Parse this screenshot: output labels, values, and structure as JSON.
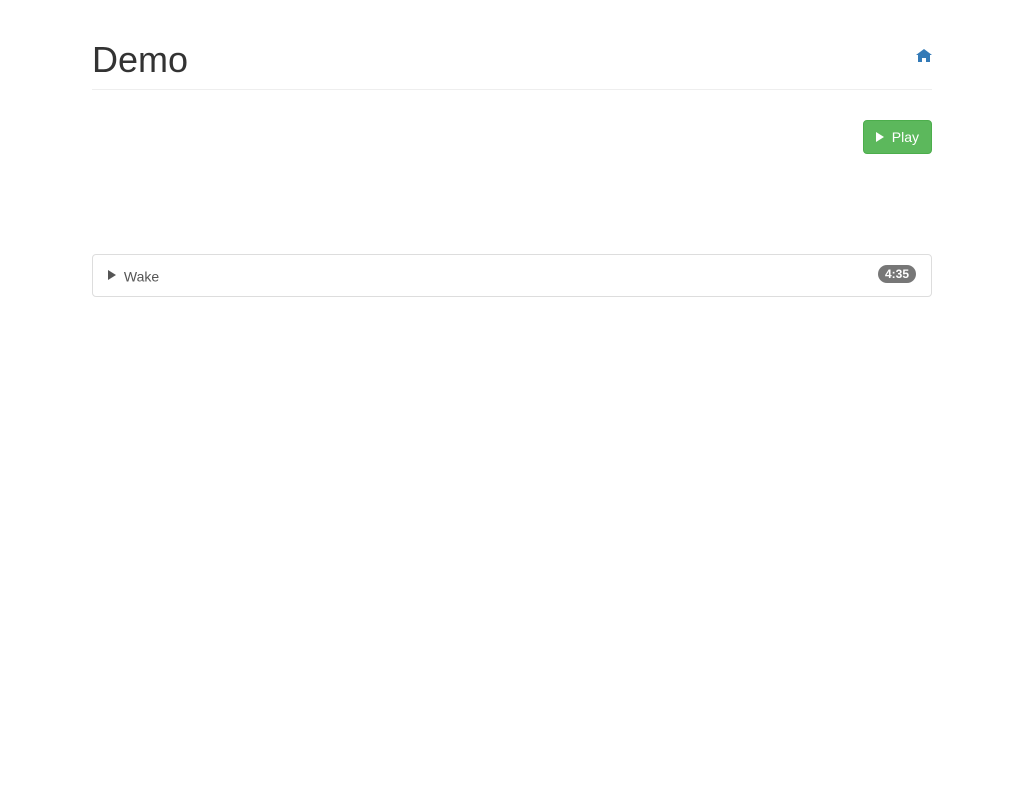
{
  "header": {
    "title": "Demo"
  },
  "controls": {
    "play_label": "Play"
  },
  "tracks": [
    {
      "title": "Wake",
      "duration": "4:35"
    }
  ]
}
